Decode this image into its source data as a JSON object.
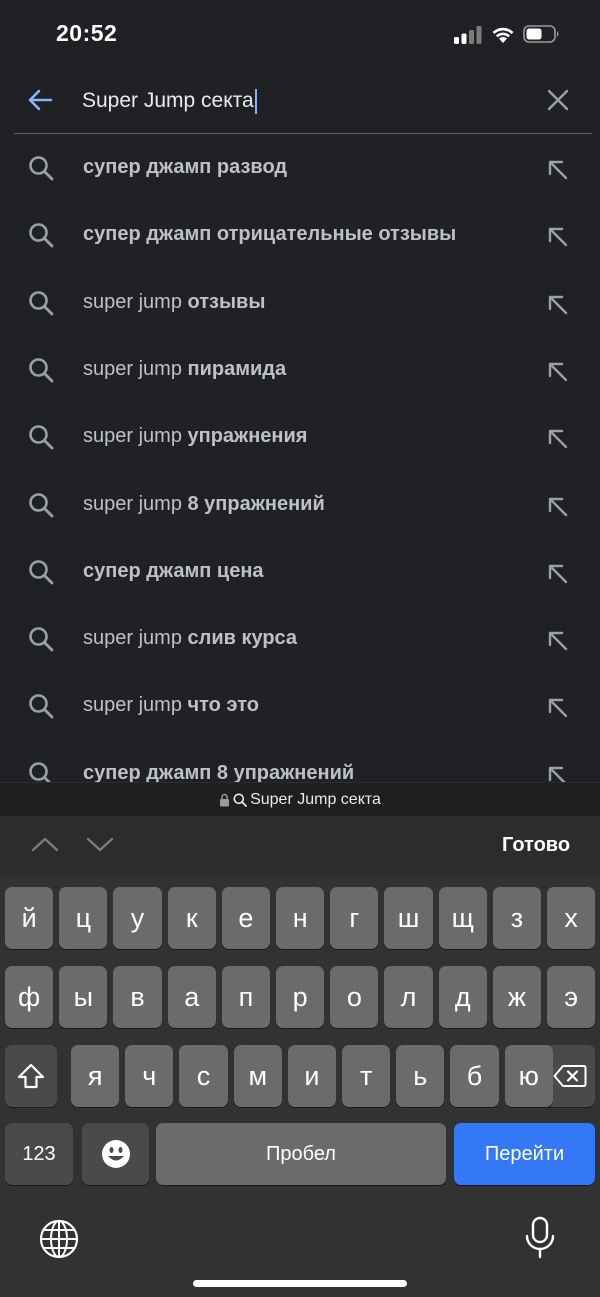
{
  "status": {
    "time": "20:52"
  },
  "search": {
    "query": "Super Jump секта"
  },
  "suggestions": [
    {
      "prefix": "",
      "bold": "супер джамп развод"
    },
    {
      "prefix": "",
      "bold": "супер джамп отрицательные отзывы"
    },
    {
      "prefix": "super jump ",
      "bold": "отзывы"
    },
    {
      "prefix": "super jump ",
      "bold": "пирамида"
    },
    {
      "prefix": "super jump ",
      "bold": "упражнения"
    },
    {
      "prefix": "super jump ",
      "bold": "8 упражнений"
    },
    {
      "prefix": "",
      "bold": "супер джамп цена"
    },
    {
      "prefix": "super jump ",
      "bold": "слив курса"
    },
    {
      "prefix": "super jump ",
      "bold": "что это"
    },
    {
      "prefix": "",
      "bold": "супер джамп 8 упражнений"
    }
  ],
  "url_bar": {
    "text": "Super Jump секта"
  },
  "accessory": {
    "done_label": "Готово"
  },
  "keyboard": {
    "row1": [
      "й",
      "ц",
      "у",
      "к",
      "е",
      "н",
      "г",
      "ш",
      "щ",
      "з",
      "х"
    ],
    "row2": [
      "ф",
      "ы",
      "в",
      "а",
      "п",
      "р",
      "о",
      "л",
      "д",
      "ж",
      "э"
    ],
    "row3": [
      "я",
      "ч",
      "с",
      "м",
      "и",
      "т",
      "ь",
      "б",
      "ю"
    ],
    "numbers_label": "123",
    "space_label": "Пробел",
    "go_label": "Перейти"
  },
  "colors": {
    "accent": "#8ab4f8",
    "go_key": "#3478f6",
    "background": "#202124"
  },
  "icons": [
    "back-arrow-icon",
    "clear-icon",
    "search-icon",
    "fill-arrow-icon",
    "lock-icon",
    "chevron-up-icon",
    "chevron-down-icon",
    "shift-icon",
    "backspace-icon",
    "emoji-icon",
    "globe-icon",
    "microphone-icon"
  ]
}
